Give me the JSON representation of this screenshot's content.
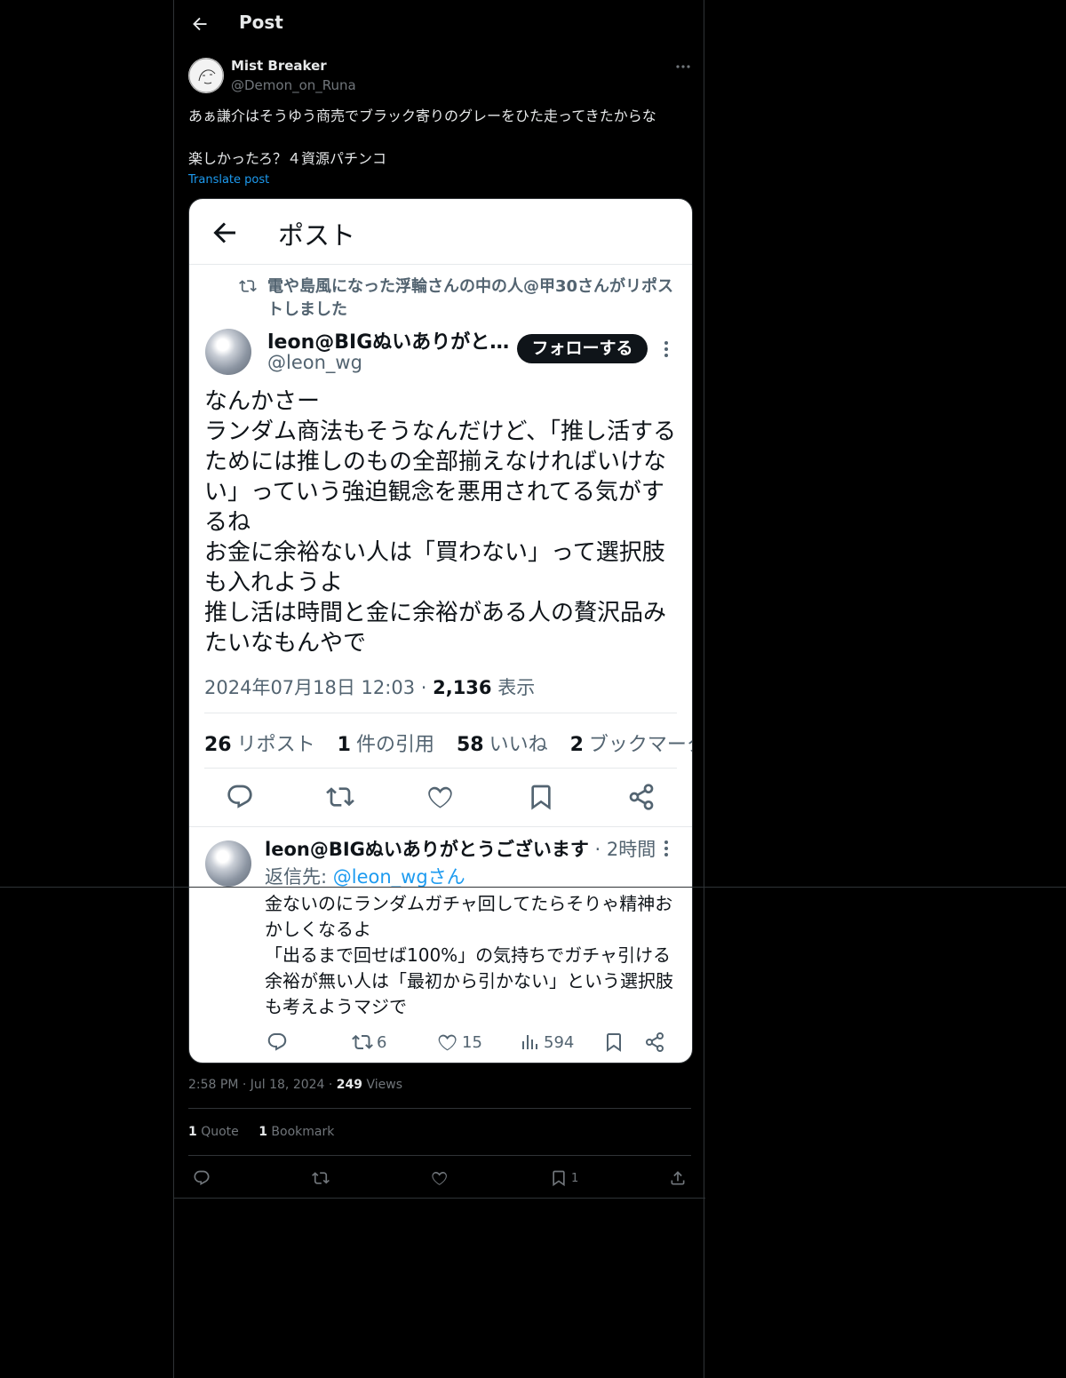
{
  "header": {
    "title": "Post"
  },
  "author": {
    "name": "Mist Breaker",
    "handle": "@Demon_on_Runa"
  },
  "post": {
    "line1": "あぁ謙介はそうゆう商売でブラック寄りのグレーをひた走ってきたからな",
    "line2": "楽しかったろ？４資源パチンコ",
    "translate": "Translate post"
  },
  "embedded": {
    "title": "ポスト",
    "repost_note": "電や島風になった浮輪さんの中の人@甲30さんがリポストしました",
    "name": "leon@BIGぬいありがと…",
    "handle": "@leon_wg",
    "follow": "フォローする",
    "body": [
      "なんかさー",
      "ランダム商法もそうなんだけど、「推し活するためには推しのもの全部揃えなければいけない」っていう強迫観念を悪用されてる気がするね",
      "お金に余裕ない人は「買わない」って選択肢も入れようよ",
      "推し活は時間と金に余裕がある人の贅沢品みたいなもんやで"
    ],
    "datetime": "2024年07月18日 12:03 · ",
    "views_num": "2,136",
    "views_label": " 表示",
    "stats": {
      "reposts": "26",
      "reposts_label": "リポスト",
      "quotes": "1",
      "quotes_label": "件の引用",
      "likes": "58",
      "likes_label": "いいね",
      "bookmarks": "2",
      "bookmarks_label": "ブックマーク"
    },
    "reply": {
      "name": "leon@BIGぬいありがとうございます",
      "time": " · 2時間",
      "to_prefix": "返信先: ",
      "to_handle": "@leon_wgさん",
      "body": [
        "金ないのにランダムガチャ回してたらそりゃ精神おかしくなるよ",
        "「出るまで回せば100%」の気持ちでガチャ引ける余裕が無い人は「最初から引かない」という選択肢も考えようマジで"
      ],
      "reposts": "6",
      "likes": "15",
      "views": "594"
    }
  },
  "meta": {
    "time": "2:58 PM · Jul 18, 2024 · ",
    "views_num": "249",
    "views_label": " Views"
  },
  "counts": {
    "quotes_num": "1",
    "quotes_label": " Quote",
    "bookmarks_num": "1",
    "bookmarks_label": " Bookmark"
  },
  "actions": {
    "bookmark_count": "1"
  }
}
